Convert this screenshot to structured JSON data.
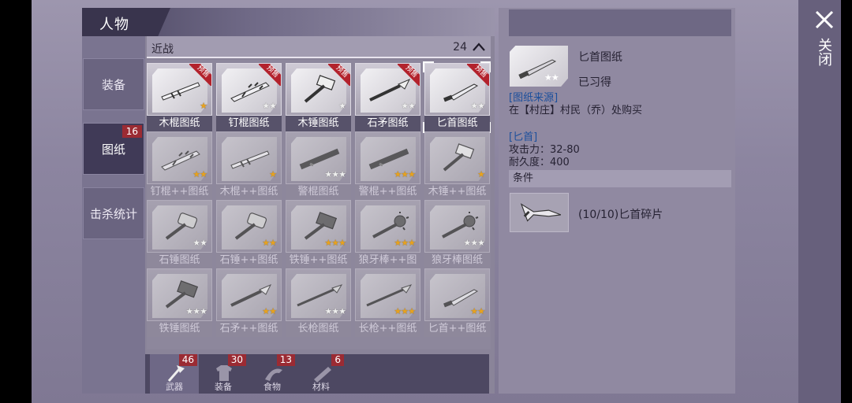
{
  "window": {
    "title": "人物"
  },
  "side_tabs": [
    {
      "label": "装备"
    },
    {
      "label": "图纸",
      "badge": "16"
    },
    {
      "label": "击杀统计"
    }
  ],
  "grid_header": {
    "category": "近战",
    "count": "24"
  },
  "cards": [
    {
      "label": "木棍图纸",
      "stars": 1,
      "max": 1,
      "ribbon": "预售",
      "locked": false,
      "icon": "stick-icon"
    },
    {
      "label": "钉棍图纸",
      "stars": 0,
      "max": 2,
      "ribbon": "预售",
      "locked": false,
      "icon": "spiked-club-icon"
    },
    {
      "label": "木锤图纸",
      "stars": 0,
      "max": 1,
      "ribbon": "预售",
      "locked": false,
      "icon": "wood-hammer-icon"
    },
    {
      "label": "石矛图纸",
      "stars": 0,
      "max": 2,
      "ribbon": "预售",
      "locked": false,
      "icon": "stone-spear-icon"
    },
    {
      "label": "匕首图纸",
      "stars": 0,
      "max": 2,
      "ribbon": "预售",
      "locked": false,
      "icon": "dagger-icon",
      "selected": true
    },
    {
      "label": "钉棍++图纸",
      "stars": 2,
      "max": 2,
      "locked": true,
      "icon": "spiked-club-icon"
    },
    {
      "label": "木棍++图纸",
      "stars": 1,
      "max": 1,
      "locked": true,
      "icon": "stick-icon"
    },
    {
      "label": "警棍图纸",
      "stars": 0,
      "max": 3,
      "locked": true,
      "icon": "baton-icon"
    },
    {
      "label": "警棍++图纸",
      "stars": 3,
      "max": 3,
      "locked": true,
      "icon": "baton-icon"
    },
    {
      "label": "木锤++图纸",
      "stars": 1,
      "max": 1,
      "locked": true,
      "icon": "wood-hammer-icon"
    },
    {
      "label": "石锤图纸",
      "stars": 0,
      "max": 2,
      "locked": true,
      "icon": "stone-hammer-icon"
    },
    {
      "label": "石锤++图纸",
      "stars": 2,
      "max": 2,
      "locked": true,
      "icon": "stone-hammer-icon"
    },
    {
      "label": "铁锤++图纸",
      "stars": 3,
      "max": 3,
      "locked": true,
      "icon": "iron-hammer-icon"
    },
    {
      "label": "狼牙棒++图纸",
      "stars": 3,
      "max": 3,
      "locked": true,
      "icon": "mace-icon"
    },
    {
      "label": "狼牙棒图纸",
      "stars": 0,
      "max": 3,
      "locked": true,
      "icon": "mace-icon"
    },
    {
      "label": "铁锤图纸",
      "stars": 0,
      "max": 3,
      "locked": true,
      "icon": "iron-hammer-icon"
    },
    {
      "label": "石矛++图纸",
      "stars": 2,
      "max": 2,
      "locked": true,
      "icon": "stone-spear-icon"
    },
    {
      "label": "长枪图纸",
      "stars": 0,
      "max": 3,
      "locked": true,
      "icon": "long-spear-icon"
    },
    {
      "label": "长枪++图纸",
      "stars": 3,
      "max": 3,
      "locked": true,
      "icon": "long-spear-icon"
    },
    {
      "label": "匕首++图纸",
      "stars": 2,
      "max": 2,
      "locked": true,
      "icon": "dagger-icon"
    }
  ],
  "bottom_tabs": [
    {
      "label": "武器",
      "badge": "46",
      "icon": "axe-icon",
      "active": true
    },
    {
      "label": "装备",
      "badge": "30",
      "icon": "shirt-icon"
    },
    {
      "label": "食物",
      "badge": "13",
      "icon": "food-icon"
    },
    {
      "label": "材料",
      "badge": "6",
      "icon": "material-icon"
    }
  ],
  "detail": {
    "name": "匕首图纸",
    "status": "已习得",
    "source_title": "[图纸来源]",
    "source_text": "在【村庄】村民（乔）处购买",
    "weapon_title": "[匕首]",
    "attack": "攻击力：32-80",
    "durability": "耐久度：400",
    "condition_title": "条件",
    "condition_text": "(10/10)匕首碎片"
  },
  "close": {
    "label": "关闭"
  },
  "colors": {
    "badge": "#9b2b33",
    "star": "#e8a21d",
    "link": "#1c4f9c"
  }
}
